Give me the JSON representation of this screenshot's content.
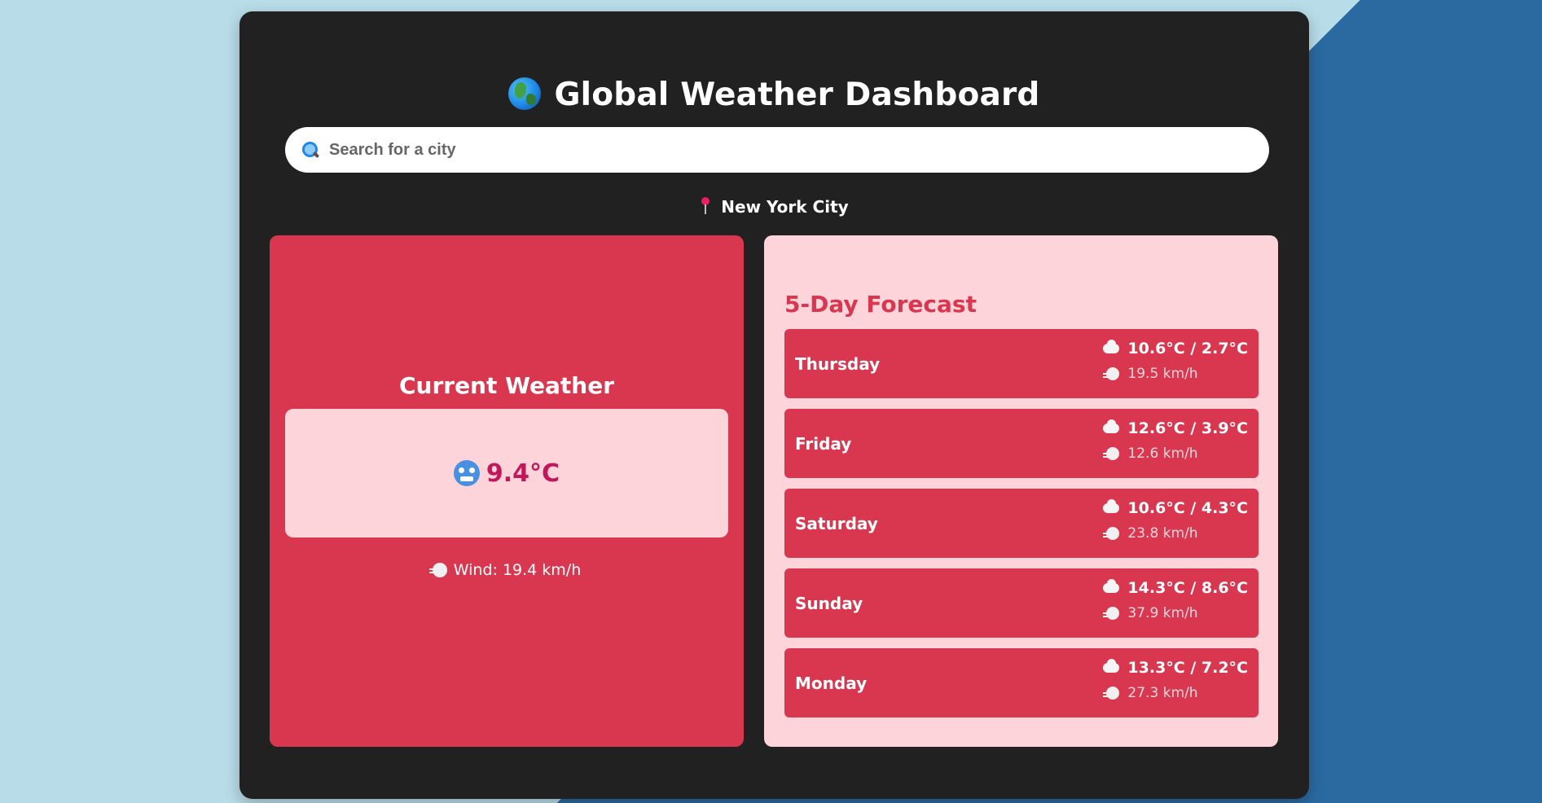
{
  "app": {
    "title": "Global Weather Dashboard",
    "title_icon": "globe-icon"
  },
  "search": {
    "placeholder": "Search for a city",
    "value": "",
    "icon": "search-icon"
  },
  "location": {
    "name": "New York City",
    "icon": "pin-icon"
  },
  "current": {
    "heading": "Current Weather",
    "temperature": "9.4°C",
    "condition_icon": "cold-face-icon",
    "wind": "Wind: 19.4 km/h"
  },
  "forecast": {
    "heading": "5-Day Forecast",
    "days": [
      {
        "day": "Thursday",
        "temps": "10.6°C / 2.7°C",
        "wind": "19.5 km/h",
        "icon": "cloud-icon"
      },
      {
        "day": "Friday",
        "temps": "12.6°C / 3.9°C",
        "wind": "12.6 km/h",
        "icon": "cloud-icon"
      },
      {
        "day": "Saturday",
        "temps": "10.6°C / 4.3°C",
        "wind": "23.8 km/h",
        "icon": "cloud-icon"
      },
      {
        "day": "Sunday",
        "temps": "14.3°C / 8.6°C",
        "wind": "37.9 km/h",
        "icon": "cloud-icon"
      },
      {
        "day": "Monday",
        "temps": "13.3°C / 7.2°C",
        "wind": "27.3 km/h",
        "icon": "cloud-icon"
      }
    ]
  },
  "colors": {
    "panel": "#212121",
    "accent": "#d9374f",
    "accent_light": "#fcd4da",
    "temp_text": "#c2185b",
    "bg_light": "#b8dce8",
    "bg_dark": "#2a6aa1"
  }
}
